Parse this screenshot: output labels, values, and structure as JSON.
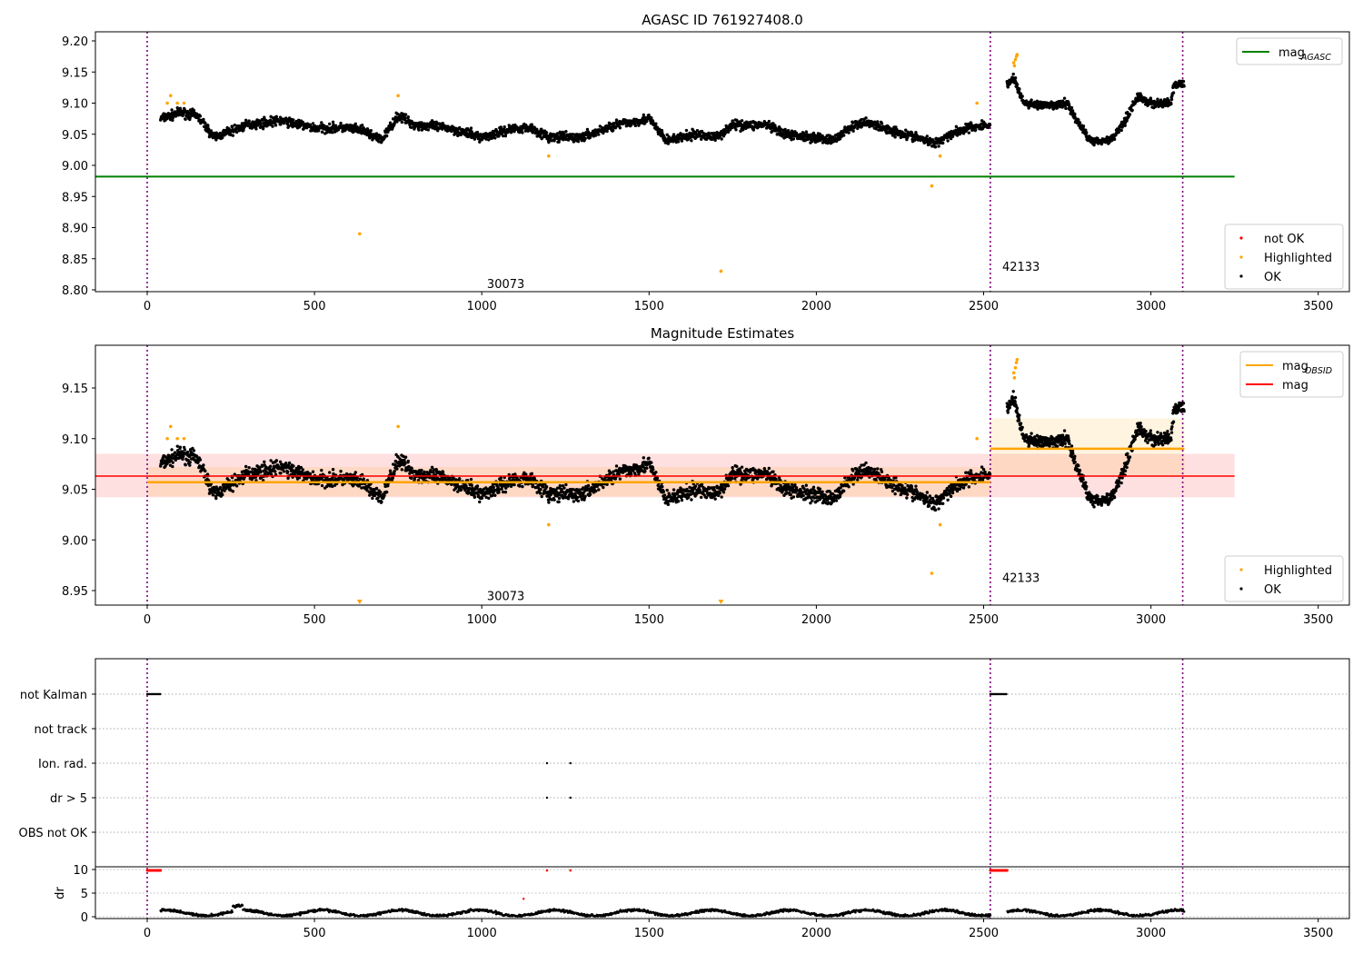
{
  "chart_data": [
    {
      "type": "scatter",
      "title": "AGASC ID 761927408.0",
      "xlim": [
        -155,
        3595
      ],
      "ylim": [
        8.797,
        9.208
      ],
      "xticks": [
        0,
        500,
        1000,
        1500,
        2000,
        2500,
        3000,
        3500
      ],
      "yticks": [
        "8.80",
        "8.85",
        "8.90",
        "8.95",
        "9.00",
        "9.05",
        "9.10",
        "9.15",
        "9.20"
      ],
      "mag_agasc": 8.982,
      "mag_agasc_xrange": [
        -155,
        3250
      ],
      "legend_lines": [
        {
          "label": "mag",
          "sub": "AGASC",
          "color": "#008000"
        }
      ],
      "legend_points": [
        {
          "label": "not OK",
          "color": "#ff0000"
        },
        {
          "label": "Highlighted",
          "color": "#ffa500"
        },
        {
          "label": "OK",
          "color": "#000000"
        }
      ],
      "obsid_labels": [
        {
          "text": "30073",
          "x": 1260,
          "y": 8.81
        },
        {
          "text": "42133",
          "x": 2800,
          "y": 8.838
        }
      ]
    },
    {
      "type": "scatter",
      "title": "Magnitude Estimates",
      "xlim": [
        -155,
        3595
      ],
      "ylim": [
        8.935,
        9.193
      ],
      "xticks": [
        0,
        500,
        1000,
        1500,
        2000,
        2500,
        3000,
        3500
      ],
      "yticks": [
        "8.95",
        "9.00",
        "9.05",
        "9.10",
        "9.15"
      ],
      "mag": 9.063,
      "mag_band": [
        9.042,
        9.085
      ],
      "obsid_mags": [
        {
          "obsid": "30073",
          "x": [
            0,
            2520
          ],
          "mag": 9.057,
          "band": [
            9.043,
            9.072
          ]
        },
        {
          "obsid": "42133",
          "x": [
            2520,
            3100
          ],
          "mag": 9.09,
          "band": [
            9.063,
            9.12
          ]
        }
      ],
      "legend_lines": [
        {
          "label": "mag",
          "sub": "OBSID",
          "color": "#ffa500"
        },
        {
          "label": "mag",
          "sub": "",
          "color": "#ff0000"
        }
      ],
      "legend_points": [
        {
          "label": "Highlighted",
          "color": "#ffa500"
        },
        {
          "label": "OK",
          "color": "#000000"
        }
      ],
      "obsid_labels": [
        {
          "text": "30073",
          "x": 1260,
          "y": 8.945
        },
        {
          "text": "42133",
          "x": 2800,
          "y": 8.963
        }
      ]
    },
    {
      "type": "scatter",
      "flags": [
        "not Kalman",
        "not track",
        "Ion. rad.",
        "dr > 5",
        "OBS not OK"
      ],
      "flag_points": {
        "not Kalman": [
          [
            0,
            40
          ],
          [
            2520,
            2570
          ]
        ],
        "Ion. rad.": [
          1195,
          1265
        ],
        "dr > 5": [
          1195,
          1265
        ]
      },
      "dr_ylabel": "dr",
      "dr_yticks": [
        "0",
        "5",
        "10"
      ],
      "xticks": [
        0,
        500,
        1000,
        1500,
        2000,
        2500,
        3000,
        3500
      ]
    },
    {
      "series_trend": {
        "x": [
          40,
          100,
          150,
          200,
          300,
          400,
          500,
          600,
          650,
          700,
          750,
          800,
          900,
          1000,
          1100,
          1150,
          1200,
          1300,
          1400,
          1450,
          1500,
          1550,
          1650,
          1700,
          1750,
          1850,
          1900,
          2000,
          2050,
          2100,
          2150,
          2200,
          2300,
          2350,
          2400,
          2450,
          2520
        ],
        "mag": [
          9.075,
          9.085,
          9.08,
          9.045,
          9.065,
          9.072,
          9.06,
          9.06,
          9.055,
          9.04,
          9.08,
          9.065,
          9.06,
          9.045,
          9.06,
          9.06,
          9.045,
          9.045,
          9.065,
          9.07,
          9.075,
          9.04,
          9.05,
          9.045,
          9.065,
          9.065,
          9.05,
          9.045,
          9.04,
          9.06,
          9.07,
          9.06,
          9.045,
          9.035,
          9.05,
          9.06,
          9.065
        ]
      },
      "series_trend2": {
        "x": [
          2570,
          2590,
          2620,
          2700,
          2750,
          2780,
          2820,
          2880,
          2920,
          2960,
          3000,
          3060,
          3070,
          3100
        ],
        "mag": [
          9.13,
          9.14,
          9.1,
          9.095,
          9.1,
          9.07,
          9.04,
          9.04,
          9.07,
          9.11,
          9.1,
          9.1,
          9.13,
          9.13
        ]
      },
      "obsid_boundaries": [
        0,
        2520,
        3095
      ],
      "highlighted": [
        [
          60,
          9.1
        ],
        [
          70,
          9.112
        ],
        [
          90,
          9.1
        ],
        [
          110,
          9.1
        ],
        [
          635,
          8.89
        ],
        [
          750,
          9.112
        ],
        [
          1200,
          9.015
        ],
        [
          1715,
          8.83
        ],
        [
          2345,
          8.967
        ],
        [
          2370,
          9.015
        ],
        [
          2480,
          9.1
        ],
        [
          2590,
          9.165
        ],
        [
          2595,
          9.17
        ],
        [
          2600,
          9.178
        ],
        [
          2598,
          9.175
        ],
        [
          2592,
          9.16
        ]
      ],
      "not_ok_dr": [
        1125,
        3.8
      ]
    }
  ]
}
